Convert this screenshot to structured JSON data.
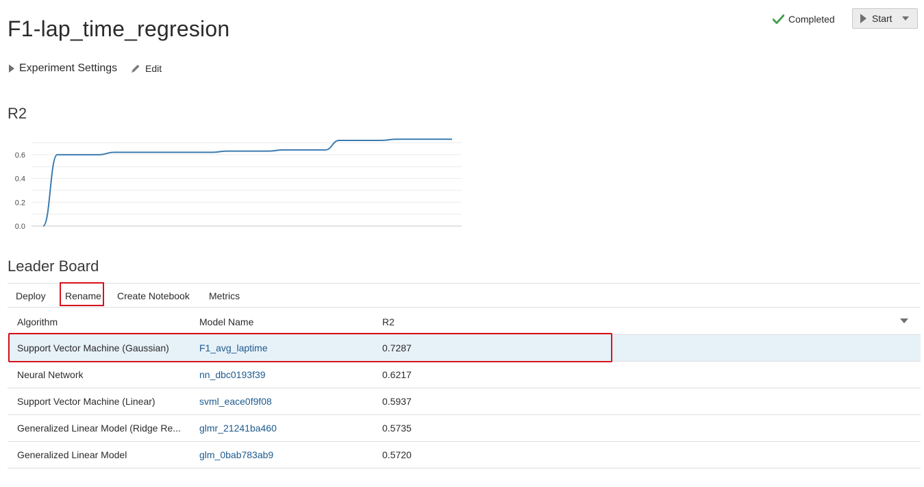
{
  "page_title": "F1-lap_time_regresion",
  "status": {
    "label": "Completed",
    "icon": "check-icon",
    "color": "#48a04f"
  },
  "start_button": {
    "label": "Start"
  },
  "experiment_settings": {
    "label": "Experiment Settings"
  },
  "edit": {
    "label": "Edit"
  },
  "chart_section_title": "R2",
  "chart_data": {
    "type": "line",
    "title": "R2",
    "xlabel": "",
    "ylabel": "",
    "ylim": [
      0,
      0.72
    ],
    "yticks": [
      "0.0",
      "0.2",
      "0.4",
      "0.6"
    ],
    "grid": true,
    "color": "#3a7bb0",
    "series": [
      {
        "values": [
          0.0,
          0.6,
          0.6,
          0.6,
          0.6,
          0.62,
          0.62,
          0.62,
          0.62,
          0.62,
          0.62,
          0.62,
          0.62,
          0.63,
          0.63,
          0.63,
          0.63,
          0.64,
          0.64,
          0.64,
          0.64,
          0.72,
          0.72,
          0.72,
          0.72,
          0.73,
          0.73,
          0.73,
          0.73,
          0.73
        ]
      }
    ]
  },
  "leaderboard": {
    "title": "Leader Board",
    "toolbar": [
      "Deploy",
      "Rename",
      "Create Notebook",
      "Metrics"
    ],
    "columns": [
      "Algorithm",
      "Model Name",
      "R2"
    ],
    "rows": [
      {
        "algorithm": "Support Vector Machine (Gaussian)",
        "model": "F1_avg_laptime",
        "r2": "0.7287"
      },
      {
        "algorithm": "Neural Network",
        "model": "nn_dbc0193f39",
        "r2": "0.6217"
      },
      {
        "algorithm": "Support Vector Machine (Linear)",
        "model": "svml_eace0f9f08",
        "r2": "0.5937"
      },
      {
        "algorithm": "Generalized Linear Model (Ridge Re...",
        "model": "glmr_21241ba460",
        "r2": "0.5735"
      },
      {
        "algorithm": "Generalized Linear Model",
        "model": "glm_0bab783ab9",
        "r2": "0.5720"
      }
    ]
  }
}
